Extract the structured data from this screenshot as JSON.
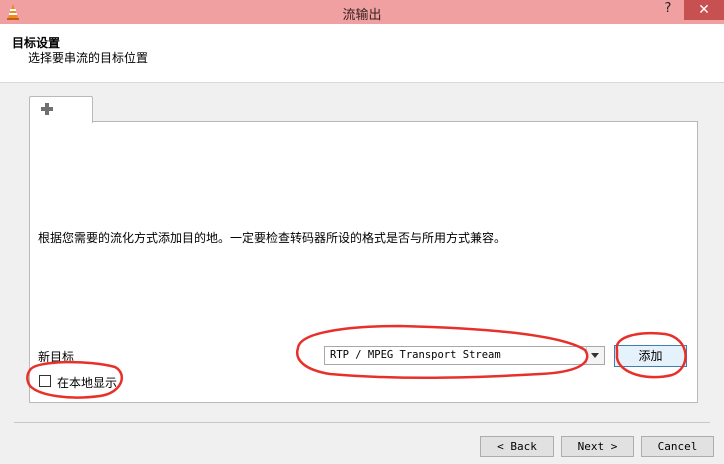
{
  "window": {
    "title": "流输出",
    "help_label": "?",
    "close_label": "✕"
  },
  "header": {
    "title": "目标设置",
    "subtitle": "选择要串流的目标位置"
  },
  "tabs": [
    {
      "icon": "plus-icon"
    }
  ],
  "panel": {
    "description": "根据您需要的流化方式添加目的地。一定要检查转码器所设的格式是否与所用方式兼容。",
    "new_target_label": "新目标",
    "dropdown": {
      "selected": "RTP / MPEG Transport Stream"
    },
    "add_button_label": "添加",
    "display_locally_label": "在本地显示",
    "display_locally_checked": false
  },
  "footer": {
    "back_label": "< Back",
    "next_label": "Next >",
    "cancel_label": "Cancel"
  },
  "colors": {
    "titlebar": "#f0a0a0",
    "close_button": "#c75050",
    "annotation": "#e8302a",
    "add_button_border": "#3c7fb1"
  }
}
